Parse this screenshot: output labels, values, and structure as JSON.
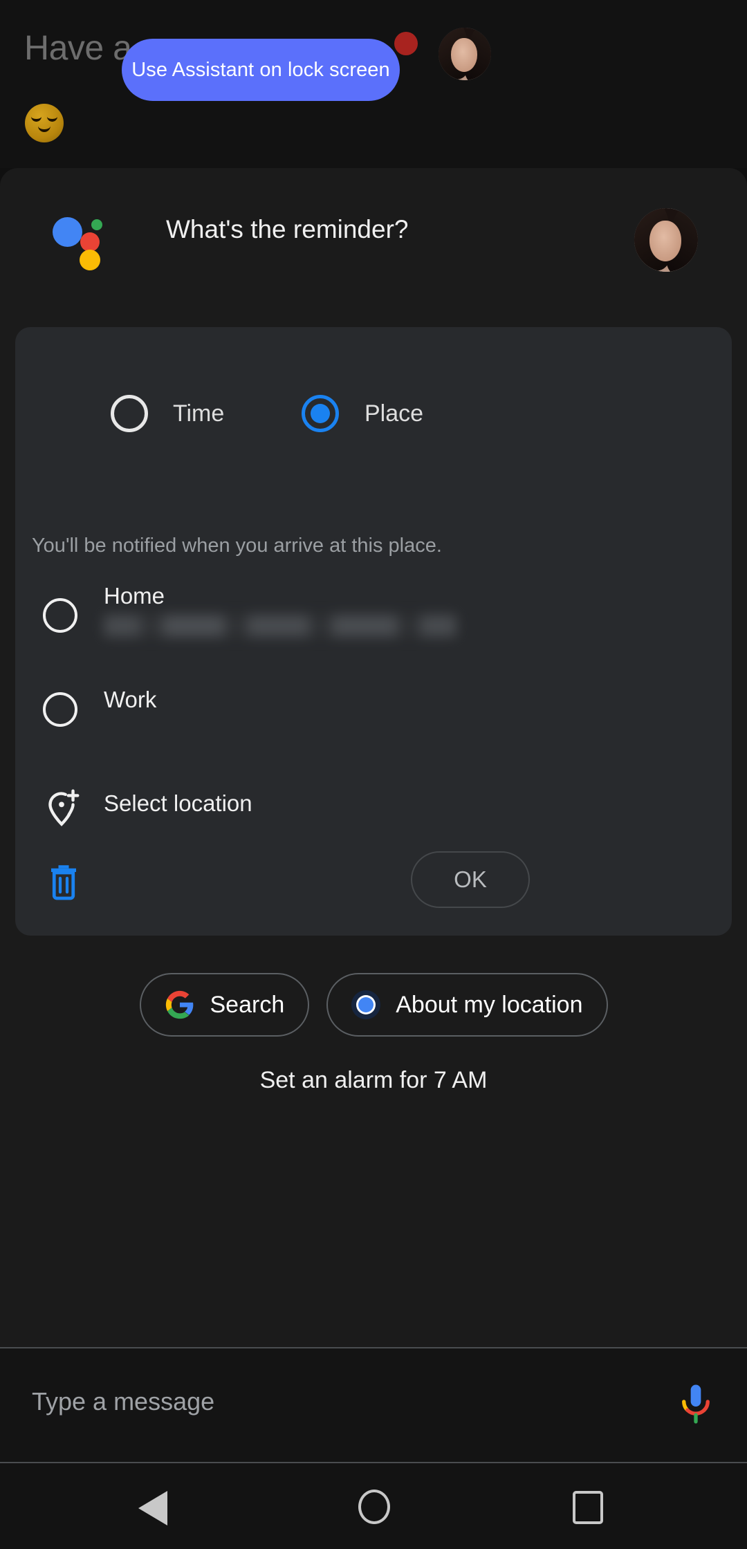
{
  "top": {
    "greeting_visible": "Have a g",
    "greeting_emoji": "relieved-face-emoji",
    "tooltip_label": "Use Assistant on lock screen",
    "tooltip_color": "#5b70fb",
    "notification_dot_color": "#a8231f"
  },
  "assistant": {
    "logo": "google-assistant-logo",
    "question": "What's the reminder?"
  },
  "card": {
    "modes": [
      {
        "label": "Time",
        "selected": false
      },
      {
        "label": "Place",
        "selected": true
      }
    ],
    "hint": "You'll be notified when you arrive at this place.",
    "places": [
      {
        "label": "Home",
        "selected": false,
        "address_redacted": true
      },
      {
        "label": "Work",
        "selected": false
      }
    ],
    "select_location_label": "Select location",
    "select_location_icon": "add-location-pin-icon",
    "delete_icon": "trash-icon",
    "delete_icon_color": "#1a82f0",
    "ok_label": "OK",
    "accent_color": "#1a82f0"
  },
  "chips": [
    {
      "label": "Search",
      "icon": "google-g-icon"
    },
    {
      "label": "About my location",
      "icon": "location-dot-icon"
    }
  ],
  "suggestion": {
    "alarm_text": "Set an alarm for 7 AM"
  },
  "input": {
    "placeholder": "Type a message",
    "mic_icon": "google-mic-icon"
  },
  "navbar": {
    "back": "back-triangle-icon",
    "home": "home-circle-icon",
    "recents": "recents-square-icon"
  }
}
